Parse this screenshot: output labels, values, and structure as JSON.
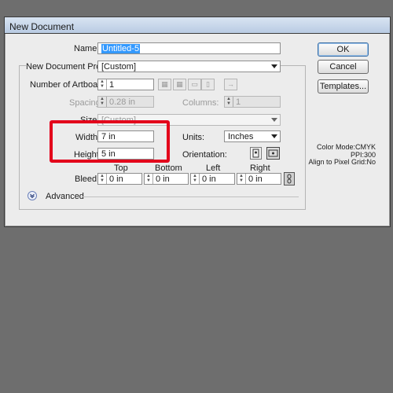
{
  "dialog": {
    "title": "New Document",
    "name_label": "Name:",
    "name_value": "Untitled-5",
    "profile_label": "New Document Profile:",
    "profile_value": "[Custom]",
    "artboards_label": "Number of Artboards:",
    "artboards_value": "1",
    "spacing_label": "Spacing:",
    "spacing_value": "0.28 in",
    "columns_label": "Columns:",
    "columns_value": "1",
    "size_label": "Size:",
    "size_value": "[Custom]",
    "width_label": "Width:",
    "width_value": "7 in",
    "units_label": "Units:",
    "units_value": "Inches",
    "height_label": "Height:",
    "height_value": "5 in",
    "orientation_label": "Orientation:",
    "bleed_label": "Bleed:",
    "bleed_headers": [
      "Top",
      "Bottom",
      "Left",
      "Right"
    ],
    "bleed_values": [
      "0 in",
      "0 in",
      "0 in",
      "0 in"
    ],
    "advanced_label": "Advanced",
    "buttons": {
      "ok": "OK",
      "cancel": "Cancel",
      "templates": "Templates..."
    },
    "info": {
      "color_mode": "Color Mode:CMYK",
      "ppi": "PPI:300",
      "align": "Align to Pixel Grid:No"
    }
  },
  "colors": {
    "highlight": "#e3001b",
    "selection": "#3399ff"
  }
}
